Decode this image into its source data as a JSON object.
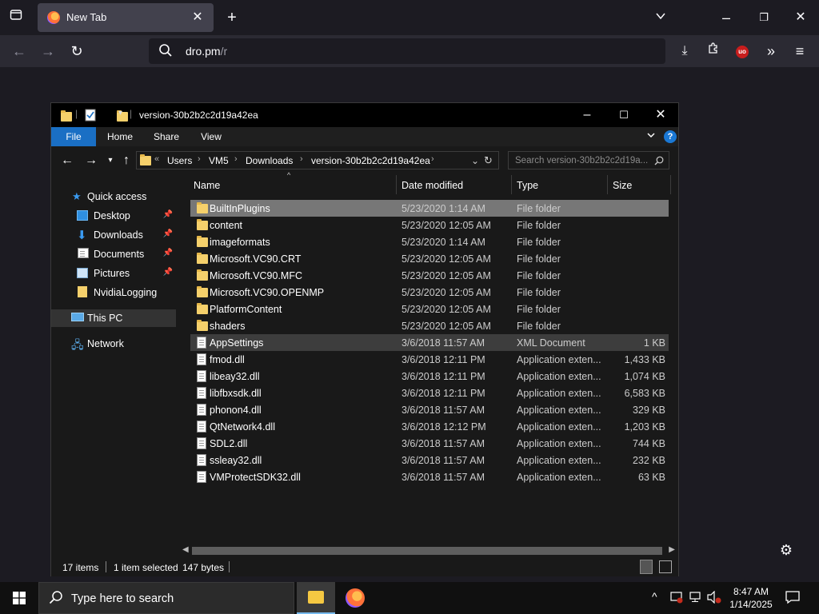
{
  "browser": {
    "tab_title": "New Tab",
    "url_host": "dro.pm",
    "url_path": "/r"
  },
  "explorer": {
    "window_title": "version-30b2b2c2d19a42ea",
    "ribbon_tabs": [
      "File",
      "Home",
      "Share",
      "View"
    ],
    "breadcrumb": [
      "Users",
      "VM5",
      "Downloads",
      "version-30b2b2c2d19a42ea"
    ],
    "breadcrumb_prefix": "«",
    "search_placeholder": "Search version-30b2b2c2d19a...",
    "nav": {
      "quick_access": "Quick access",
      "desktop": "Desktop",
      "downloads": "Downloads",
      "documents": "Documents",
      "pictures": "Pictures",
      "nvidia": "NvidiaLogging",
      "this_pc": "This PC",
      "network": "Network"
    },
    "columns": {
      "name": "Name",
      "date": "Date modified",
      "type": "Type",
      "size": "Size"
    },
    "files": [
      {
        "name": "BuiltInPlugins",
        "date": "5/23/2020 1:14 AM",
        "type": "File folder",
        "size": "",
        "kind": "folder"
      },
      {
        "name": "content",
        "date": "5/23/2020 12:05 AM",
        "type": "File folder",
        "size": "",
        "kind": "folder"
      },
      {
        "name": "imageformats",
        "date": "5/23/2020 1:14 AM",
        "type": "File folder",
        "size": "",
        "kind": "folder"
      },
      {
        "name": "Microsoft.VC90.CRT",
        "date": "5/23/2020 12:05 AM",
        "type": "File folder",
        "size": "",
        "kind": "folder"
      },
      {
        "name": "Microsoft.VC90.MFC",
        "date": "5/23/2020 12:05 AM",
        "type": "File folder",
        "size": "",
        "kind": "folder"
      },
      {
        "name": "Microsoft.VC90.OPENMP",
        "date": "5/23/2020 12:05 AM",
        "type": "File folder",
        "size": "",
        "kind": "folder"
      },
      {
        "name": "PlatformContent",
        "date": "5/23/2020 12:05 AM",
        "type": "File folder",
        "size": "",
        "kind": "folder"
      },
      {
        "name": "shaders",
        "date": "5/23/2020 12:05 AM",
        "type": "File folder",
        "size": "",
        "kind": "folder"
      },
      {
        "name": "AppSettings",
        "date": "3/6/2018 11:57 AM",
        "type": "XML Document",
        "size": "1 KB",
        "kind": "file"
      },
      {
        "name": "fmod.dll",
        "date": "3/6/2018 12:11 PM",
        "type": "Application exten...",
        "size": "1,433 KB",
        "kind": "file"
      },
      {
        "name": "libeay32.dll",
        "date": "3/6/2018 12:11 PM",
        "type": "Application exten...",
        "size": "1,074 KB",
        "kind": "file"
      },
      {
        "name": "libfbxsdk.dll",
        "date": "3/6/2018 12:11 PM",
        "type": "Application exten...",
        "size": "6,583 KB",
        "kind": "file"
      },
      {
        "name": "phonon4.dll",
        "date": "3/6/2018 11:57 AM",
        "type": "Application exten...",
        "size": "329 KB",
        "kind": "file"
      },
      {
        "name": "QtNetwork4.dll",
        "date": "3/6/2018 12:12 PM",
        "type": "Application exten...",
        "size": "1,203 KB",
        "kind": "file"
      },
      {
        "name": "SDL2.dll",
        "date": "3/6/2018 11:57 AM",
        "type": "Application exten...",
        "size": "744 KB",
        "kind": "file"
      },
      {
        "name": "ssleay32.dll",
        "date": "3/6/2018 11:57 AM",
        "type": "Application exten...",
        "size": "232 KB",
        "kind": "file"
      },
      {
        "name": "VMProtectSDK32.dll",
        "date": "3/6/2018 11:57 AM",
        "type": "Application exten...",
        "size": "63 KB",
        "kind": "file"
      }
    ],
    "status": {
      "count": "17 items",
      "selected": "1 item selected",
      "size": "147 bytes"
    }
  },
  "taskbar": {
    "search_placeholder": "Type here to search",
    "time": "8:47 AM",
    "date": "1/14/2025"
  },
  "colors": {
    "accent": "#1a6fc4",
    "selected_row": "#777777",
    "hover_row": "#3d3d3d"
  }
}
